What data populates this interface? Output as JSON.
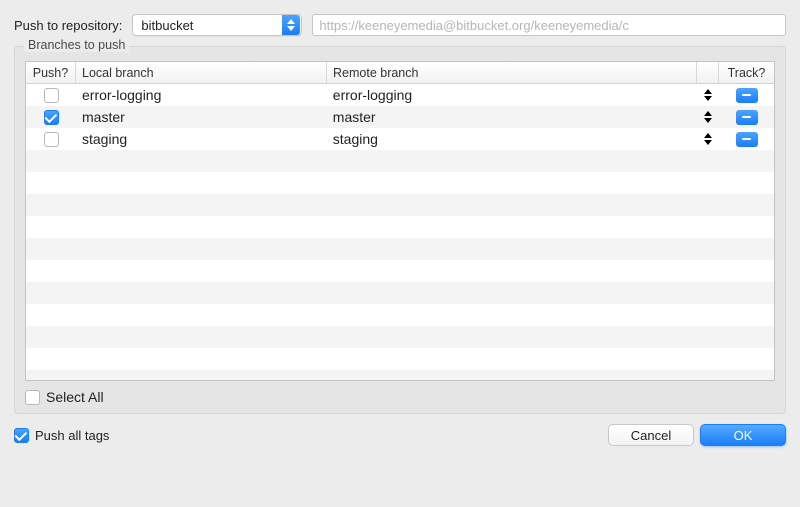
{
  "header": {
    "repo_label": "Push to repository:",
    "repo_selected": "bitbucket",
    "url": "https://keeneyemedia@bitbucket.org/keeneyemedia/c"
  },
  "group": {
    "title": "Branches to push"
  },
  "table": {
    "columns": {
      "push": "Push?",
      "local": "Local branch",
      "remote": "Remote branch",
      "track": "Track?"
    },
    "rows": [
      {
        "push": false,
        "local": "error-logging",
        "remote": "error-logging",
        "track": "minus"
      },
      {
        "push": true,
        "local": "master",
        "remote": "master",
        "track": "minus"
      },
      {
        "push": false,
        "local": "staging",
        "remote": "staging",
        "track": "minus"
      }
    ]
  },
  "select_all": {
    "label": "Select All",
    "checked": false
  },
  "push_all_tags": {
    "label": "Push all tags",
    "checked": true
  },
  "buttons": {
    "cancel": "Cancel",
    "ok": "OK"
  },
  "colors": {
    "accent": "#1a7ef5"
  }
}
